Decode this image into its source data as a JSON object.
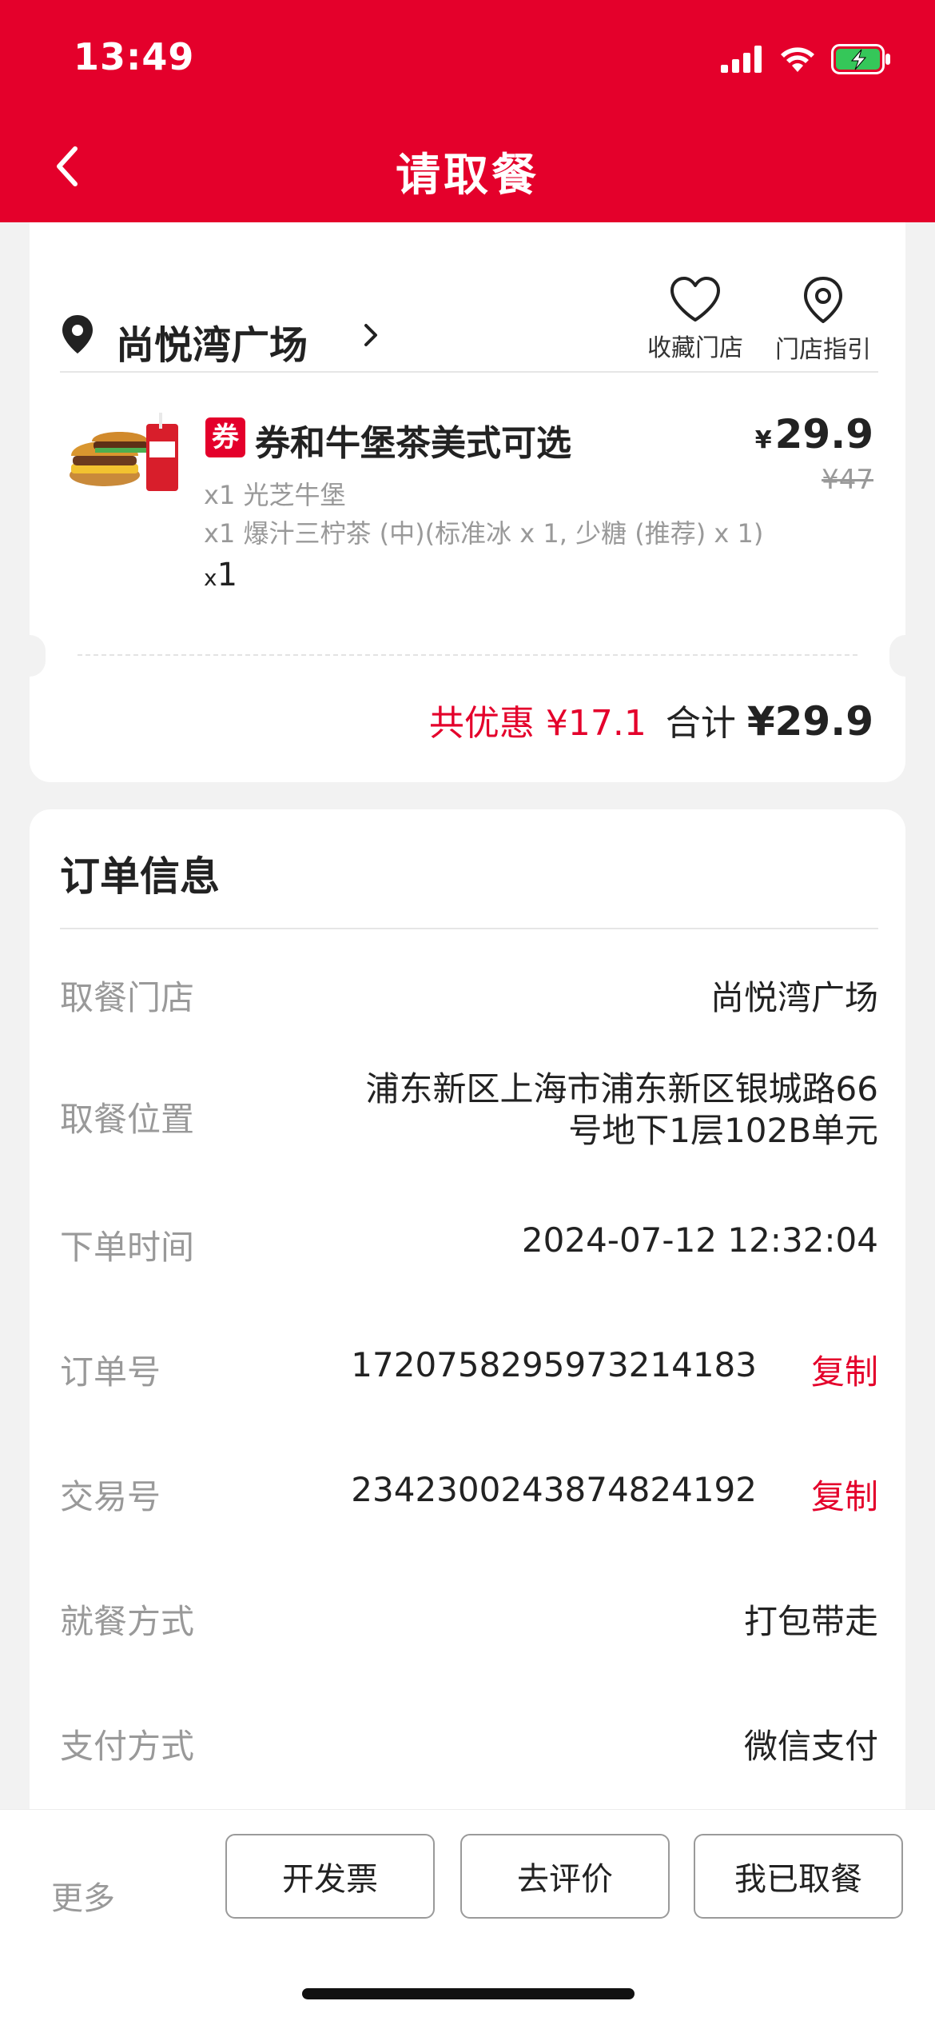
{
  "status_bar": {
    "time": "13:49",
    "icons": [
      "signal-icon",
      "wifi-icon",
      "battery-charging-icon"
    ]
  },
  "header": {
    "title": "请取餐",
    "back_icon": "chevron-left-icon",
    "background": "#e4002b"
  },
  "store": {
    "name": "尚悦湾广场",
    "actions": [
      {
        "label": "收藏门店",
        "icon": "heart-icon"
      },
      {
        "label": "门店指引",
        "icon": "location-pin-icon"
      }
    ]
  },
  "product": {
    "badge": "券",
    "name": "券和牛堡茶美式可选",
    "details": [
      "x1 光芝牛堡",
      "x1 爆汁三柠茶 (中)(标准冰 x 1, 少糖 (推荐) x 1)"
    ],
    "qty_prefix": "x",
    "qty": "1",
    "currency": "¥",
    "price": "29.9",
    "original_price": "¥47"
  },
  "totals": {
    "discount_label": "共优惠",
    "discount": "¥17.1",
    "sum_label": "合计",
    "sum": "¥29.9"
  },
  "order_info": {
    "title": "订单信息",
    "rows": [
      {
        "label": "取餐门店",
        "value": "尚悦湾广场"
      },
      {
        "label": "取餐位置",
        "value_line1": "浦东新区上海市浦东新区银城路66",
        "value_line2": "号地下1层102B单元"
      },
      {
        "label": "下单时间",
        "value": "2024-07-12 12:32:04"
      },
      {
        "label": "订单号",
        "value": "1720758295973214183",
        "action": "复制"
      },
      {
        "label": "交易号",
        "value": "2342300243874824192",
        "action": "复制"
      },
      {
        "label": "就餐方式",
        "value": "打包带走"
      },
      {
        "label": "支付方式",
        "value": "微信支付"
      }
    ]
  },
  "bottom_bar": {
    "more": "更多",
    "buttons": [
      "开发票",
      "去评价",
      "我已取餐"
    ]
  },
  "colors": {
    "accent": "#e4002b",
    "muted": "#999999"
  }
}
